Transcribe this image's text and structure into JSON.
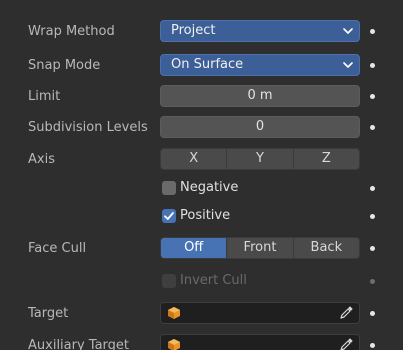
{
  "wrap_method": {
    "label": "Wrap Method",
    "value": "Project"
  },
  "snap_mode": {
    "label": "Snap Mode",
    "value": "On Surface"
  },
  "limit": {
    "label": "Limit",
    "value": "0 m"
  },
  "subdivision_levels": {
    "label": "Subdivision Levels",
    "value": "0"
  },
  "axis": {
    "label": "Axis",
    "options": [
      "X",
      "Y",
      "Z"
    ]
  },
  "negative": {
    "label": "Negative",
    "checked": false
  },
  "positive": {
    "label": "Positive",
    "checked": true
  },
  "face_cull": {
    "label": "Face Cull",
    "options": [
      "Off",
      "Front",
      "Back"
    ],
    "selected": "Off"
  },
  "invert_cull": {
    "label": "Invert Cull",
    "checked": false,
    "disabled": true
  },
  "target": {
    "label": "Target",
    "value": ""
  },
  "auxiliary_target": {
    "label": "Auxiliary Target",
    "value": ""
  },
  "colors": {
    "accent": "#4772b3",
    "dropdown": "#3d5f98",
    "object_icon": "#e8952a"
  },
  "icons": {
    "dropdown": "chevron-down-icon",
    "object": "mesh-cube-icon",
    "picker": "eyedropper-icon",
    "keyframe": "animate-dot-icon"
  }
}
